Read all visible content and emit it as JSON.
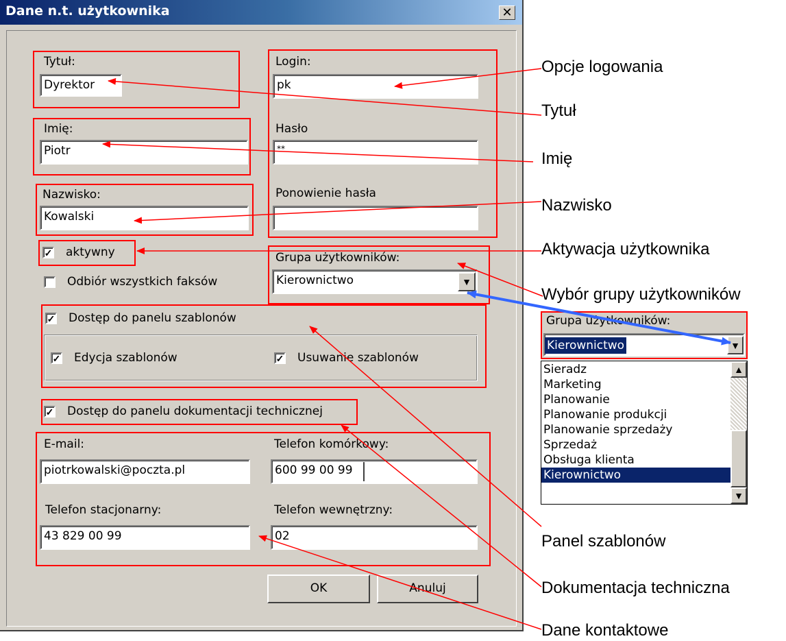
{
  "dialog": {
    "title": "Dane n.t. użytkownika",
    "close_glyph": "✕",
    "fields": {
      "title_label": "Tytuł:",
      "title_value": "Dyrektor",
      "first_name_label": "Imię:",
      "first_name_value": "Piotr",
      "last_name_label": "Nazwisko:",
      "last_name_value": "Kowalski",
      "login_label": "Login:",
      "login_value": "pk",
      "password_label": "Hasło",
      "password_value": "**",
      "password_repeat_label": "Ponowienie hasła",
      "password_repeat_value": "",
      "group_label": "Grupa użytkowników:",
      "group_value": "Kierownictwo",
      "email_label": "E-mail:",
      "email_value": "piotrkowalski@poczta.pl",
      "mobile_label": "Telefon komórkowy:",
      "mobile_value": "600 99 00 99",
      "landline_label": "Telefon stacjonarny:",
      "landline_value": "43 829 00 99",
      "internal_label": "Telefon wewnętrzny:",
      "internal_value": "02"
    },
    "checkboxes": {
      "active": {
        "label": "aktywny",
        "checked": true
      },
      "receive_all_faxes": {
        "label": "Odbiór wszystkich faksów",
        "checked": false
      },
      "templates_panel": {
        "label": "Dostęp do panelu szablonów",
        "checked": true
      },
      "edit_templates": {
        "label": "Edycja szablonów",
        "checked": true
      },
      "delete_templates": {
        "label": "Usuwanie szablonów",
        "checked": true
      },
      "tech_docs_panel": {
        "label": "Dostęp do panelu dokumentacji technicznej",
        "checked": true
      }
    },
    "buttons": {
      "ok": "OK",
      "cancel": "Anuluj"
    }
  },
  "dropdown_preview": {
    "label": "Grupa użytkowników:",
    "value": "Kierownictwo",
    "options": [
      "Sieradz",
      "Marketing",
      "Planowanie",
      "Planowanie produkcji",
      "Planowanie sprzedaży",
      "Sprzedaż",
      "Obsługa klienta",
      "Kierownictwo"
    ],
    "selected": "Kierownictwo"
  },
  "annotations": {
    "login_options": "Opcje logowania",
    "title": "Tytuł",
    "first_name": "Imię",
    "last_name": "Nazwisko",
    "user_activation": "Aktywacja użytkownika",
    "group_selection": "Wybór grupy użytkowników",
    "templates_panel": "Panel szablonów",
    "tech_docs": "Dokumentacja techniczna",
    "contact_data": "Dane kontaktowe"
  },
  "colors": {
    "highlight_box": "#ff0000",
    "arrow_red": "#ff0000",
    "arrow_blue": "#3366ff",
    "selection": "#0a246a",
    "dialog_bg": "#d4d0c8"
  }
}
